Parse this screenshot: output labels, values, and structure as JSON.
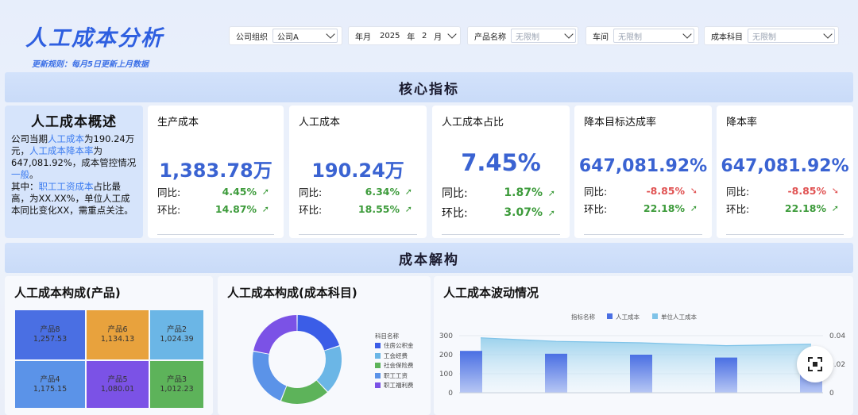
{
  "header": {
    "title": "人工成本分析",
    "update_rule": "更新规则：每月5日更新上月数据"
  },
  "filters": {
    "org": {
      "label": "公司组织",
      "value": "公司A"
    },
    "month": {
      "label": "年月",
      "year": "2025",
      "year_unit": "年",
      "month": "2",
      "month_unit": "月"
    },
    "product": {
      "label": "产品名称",
      "placeholder": "无限制"
    },
    "workshop": {
      "label": "车间",
      "placeholder": "无限制"
    },
    "subject": {
      "label": "成本科目",
      "placeholder": "无限制"
    }
  },
  "sections": {
    "core": "核心指标",
    "structure": "成本解构"
  },
  "overview": {
    "title": "人工成本概述",
    "p1_a": "公司当期",
    "p1_b": "人工成本",
    "p1_c": "为190.24万元，",
    "p1_d": "人工成本降本率",
    "p1_e": "为647,081.92%，成本管控情况",
    "p1_f": "一般",
    "p1_g": "。",
    "p2_a": "其中：",
    "p2_b": "职工工资成本",
    "p2_c": "占比最高，为XX.XX%，单位人工成本同比变化XX，需重点关注。"
  },
  "kpis": [
    {
      "name": "生产成本",
      "value": "1,383.78万",
      "yoy_label": "同比:",
      "yoy": "4.45%",
      "yoy_dir": "up",
      "mom_label": "环比:",
      "mom": "14.87%",
      "mom_dir": "up"
    },
    {
      "name": "人工成本",
      "value": "190.24万",
      "yoy_label": "同比:",
      "yoy": "6.34%",
      "yoy_dir": "up",
      "mom_label": "环比:",
      "mom": "18.55%",
      "mom_dir": "up"
    },
    {
      "name": "人工成本占比",
      "value": "7.45%",
      "yoy_label": "同比:",
      "yoy": "1.87%",
      "yoy_dir": "up",
      "mom_label": "环比:",
      "mom": "3.07%",
      "mom_dir": "up"
    },
    {
      "name": "降本目标达成率",
      "value": "647,081.92%",
      "yoy_label": "同比:",
      "yoy": "-8.85%",
      "yoy_dir": "down",
      "mom_label": "环比:",
      "mom": "22.18%",
      "mom_dir": "up"
    },
    {
      "name": "降本率",
      "value": "647,081.92%",
      "yoy_label": "同比:",
      "yoy": "-8.85%",
      "yoy_dir": "down",
      "mom_label": "环比:",
      "mom": "22.18%",
      "mom_dir": "up"
    }
  ],
  "panels": {
    "treemap_title": "人工成本构成(产品)",
    "donut_title": "人工成本构成(成本科目)",
    "trend_title": "人工成本波动情况"
  },
  "colors": {
    "primary": "#3a63d2",
    "up": "#3d9b3b",
    "down": "#e05252",
    "band": "#d3e2fb"
  },
  "chart_data": [
    {
      "type": "heatmap",
      "subtype": "treemap",
      "title": "人工成本构成(产品)",
      "items": [
        {
          "name": "产品8",
          "value": "1,257.53",
          "color": "#4a6fe3"
        },
        {
          "name": "产品6",
          "value": "1,134.13",
          "color": "#e8a23d"
        },
        {
          "name": "产品2",
          "value": "1,024.39",
          "color": "#6bb6e6"
        },
        {
          "name": "产品4",
          "value": "1,175.15",
          "color": "#5b93e8"
        },
        {
          "name": "产品5",
          "value": "1,080.01",
          "color": "#7b52e6"
        },
        {
          "name": "产品3",
          "value": "1,012.23",
          "color": "#5db35a"
        }
      ]
    },
    {
      "type": "pie",
      "donut": true,
      "title": "人工成本构成(成本科目)",
      "legend_title": "科目名称",
      "slices": [
        {
          "name": "住房公积金",
          "value": 20,
          "color": "#3b5de7"
        },
        {
          "name": "工会经费",
          "value": 18,
          "color": "#6bb6e6"
        },
        {
          "name": "社会保险费",
          "value": 18,
          "color": "#5db35a"
        },
        {
          "name": "职工工资",
          "value": 22,
          "color": "#5b93e8"
        },
        {
          "name": "职工福利费",
          "value": 22,
          "color": "#7b52e6"
        }
      ]
    },
    {
      "type": "bar",
      "title": "人工成本波动情况",
      "legend_title": "指标名称",
      "series": [
        {
          "name": "人工成本",
          "type": "bar",
          "color": "#4a6fe3",
          "values": [
            220,
            205,
            200,
            185,
            190
          ]
        },
        {
          "name": "单位人工成本",
          "type": "area",
          "color": "#7fc3e8",
          "values": [
            0.0385,
            0.036,
            0.035,
            0.033,
            0.034
          ]
        }
      ],
      "ylim": [
        0,
        300
      ],
      "y_ticks": [
        "0",
        "100",
        "200",
        "300"
      ],
      "y2lim": [
        0,
        0.04
      ],
      "y2_ticks": [
        "0",
        "0.02",
        "0.04"
      ]
    }
  ]
}
